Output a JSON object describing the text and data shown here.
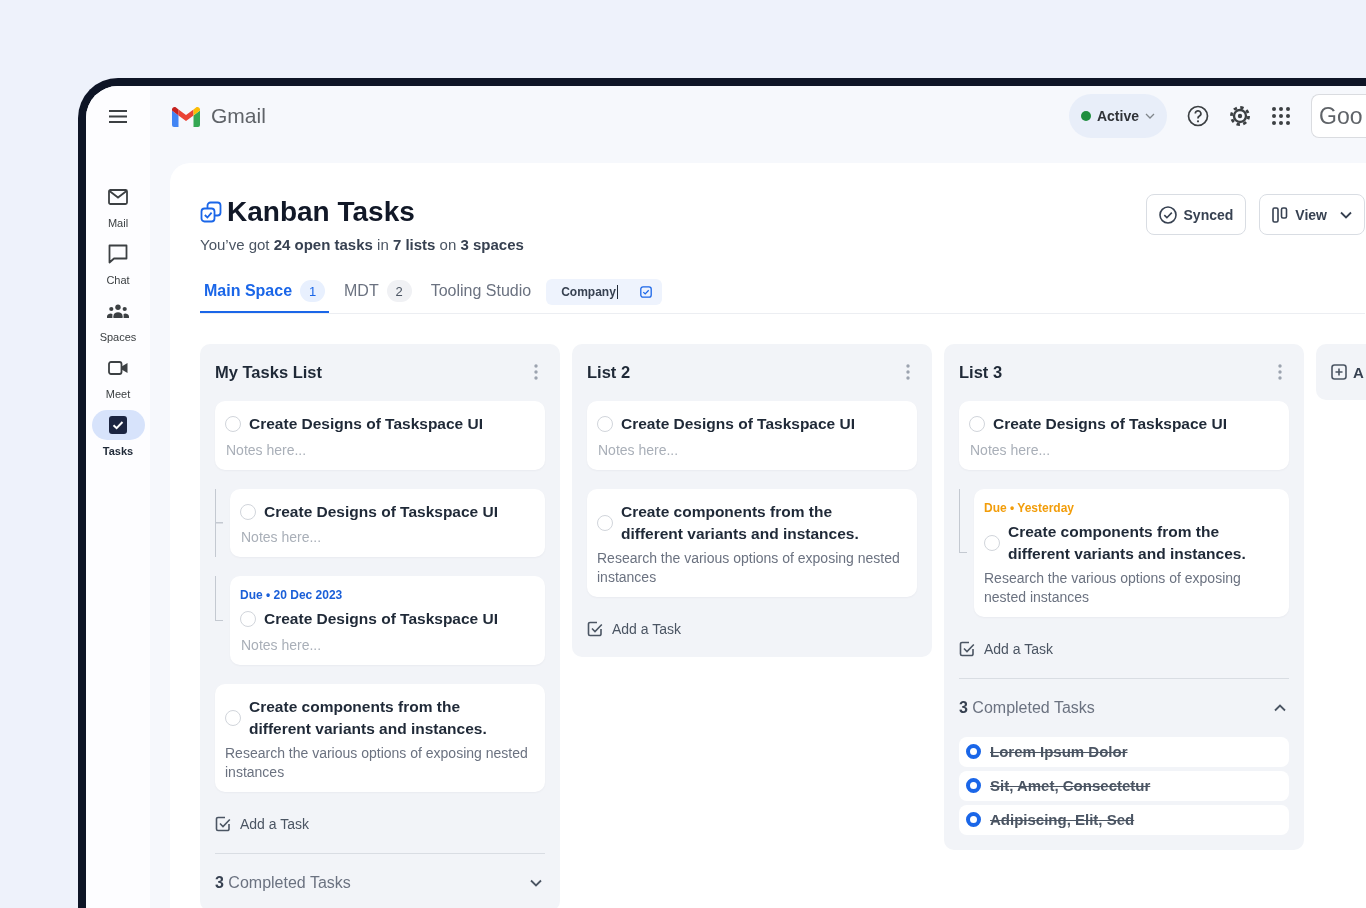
{
  "app_bar": {
    "app_name": "Gmail",
    "status": {
      "label": "Active"
    },
    "account": {
      "label": "Goo"
    }
  },
  "sidebar": {
    "items": [
      {
        "kind": "mail",
        "label": "Mail",
        "selected": false
      },
      {
        "kind": "chat",
        "label": "Chat",
        "selected": false
      },
      {
        "kind": "spaces",
        "label": "Spaces",
        "selected": false
      },
      {
        "kind": "meet",
        "label": "Meet",
        "selected": false
      },
      {
        "kind": "tasks",
        "label": "Tasks",
        "selected": true
      }
    ]
  },
  "page": {
    "title": "Kanban Tasks",
    "subtitle": "You’ve got **24 open tasks** in **7 lists** on **3 spaces**",
    "actions": [
      {
        "kind": "synced",
        "label": "Synced"
      },
      {
        "kind": "view",
        "label": "View"
      }
    ]
  },
  "tabs": [
    {
      "label": "Main Space",
      "count": "1",
      "selected": true
    },
    {
      "label": "MDT",
      "count": "2",
      "selected": false
    },
    {
      "label": "Tooling Studio",
      "selected": false
    }
  ],
  "tab_name_field": {
    "value": "Company"
  },
  "lists": [
    {
      "title": "My Tasks List",
      "tasks": [
        {
          "title": "Create Designs of Taskspace UI",
          "checked": false,
          "placeholder": "Notes here...",
          "children": [
            {
              "title": "Create Designs of Taskspace UI",
              "checked": false,
              "placeholder": "Notes here..."
            },
            {
              "due": {
                "label": "Due • 20 Dec 2023",
                "color": "#1a5fd8"
              },
              "title": "Create Designs of Taskspace UI",
              "checked": false,
              "placeholder": "Notes here..."
            }
          ]
        },
        {
          "title": "Create components from the different variants and instances.",
          "checked": false,
          "notes": "Research the various options of exposing nested instances"
        }
      ],
      "add_label": "Add a Task",
      "completed": {
        "label": "**3** Completed Tasks",
        "expanded": false
      }
    },
    {
      "title": "List 2",
      "tasks": [
        {
          "title": "Create Designs of Taskspace UI",
          "checked": false,
          "placeholder": "Notes here..."
        },
        {
          "title": "Create components from the different variants and instances.",
          "checked": false,
          "notes": "Research the various options of exposing nested instances"
        }
      ],
      "add_label": "Add a Task"
    },
    {
      "title": "List 3",
      "tasks": [
        {
          "title": "Create Designs of Taskspace UI",
          "checked": false,
          "placeholder": "Notes here...",
          "children": [
            {
              "due": {
                "label": "Due • Yesterday",
                "color": "#f29d0a"
              },
              "title": "Create components from the different variants and instances.",
              "checked": false,
              "notes": "Research the various options of exposing nested instances"
            }
          ]
        }
      ],
      "add_label": "Add a Task",
      "completed": {
        "label": "**3** Completed Tasks",
        "expanded": true,
        "tasks": [
          {
            "title": "Lorem Ipsum Dolor",
            "checked": true
          },
          {
            "title": "Sit, Amet, Consectetur",
            "checked": true
          },
          {
            "title": "Adipiscing, Elit, Sed",
            "checked": true
          }
        ]
      }
    }
  ],
  "add_list": {
    "label": "A"
  }
}
